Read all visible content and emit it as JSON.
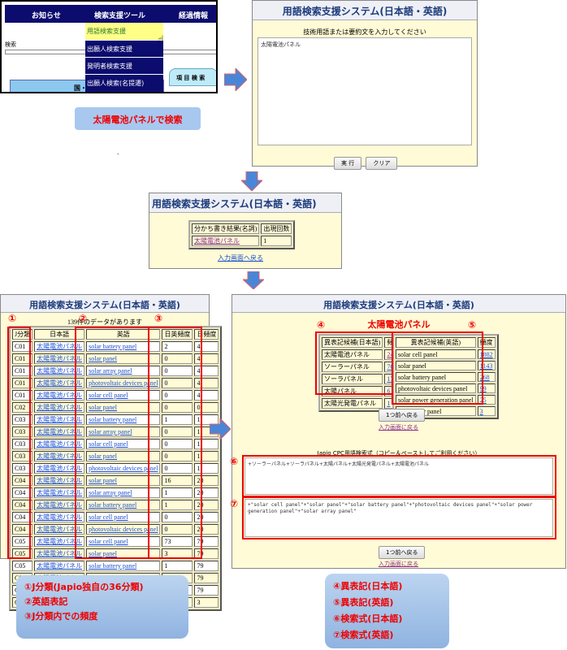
{
  "portal": {
    "nav": [
      "お知らせ",
      "検索支援ツール",
      "経過情報"
    ],
    "dropdown": [
      "用語検索支援",
      "出願人検索支援",
      "発明者検索支援",
      "出願人検索(名提遷)"
    ],
    "search_label": "検索",
    "section_label": "国・公報",
    "tab_label": "項 目 検 索"
  },
  "callout_search": "太陽電池パネルで検索",
  "input_screen": {
    "title": "用語検索支援システム(日本語・英語)",
    "prompt": "技術用語または要約文を入力してください",
    "value": "太陽電池パネル",
    "run": "実 行",
    "clear": "クリア"
  },
  "dot": ".",
  "split_screen": {
    "title": "用語検索支援システム(日本語・英語)",
    "headers": [
      "分かち書き結果(名詞)",
      "出現回数"
    ],
    "rows": [
      {
        "term": "太陽電池パネル",
        "count": "1"
      }
    ],
    "back_link": "入力画面へ戻る"
  },
  "list_screen": {
    "title": "用語検索支援システム(日本語・英語)",
    "count_text": "139件のデータがあります",
    "headers": [
      "J分類",
      "日本語",
      "英語",
      "日英頻度",
      "日頻度"
    ],
    "rows": [
      [
        "C01",
        "太陽電池パネル",
        "solar battery panel",
        "2",
        "4"
      ],
      [
        "C01",
        "太陽電池パネル",
        "solar panel",
        "0",
        "4"
      ],
      [
        "C01",
        "太陽電池パネル",
        "solar array panel",
        "0",
        "4"
      ],
      [
        "C01",
        "太陽電池パネル",
        "photovoltaic devices panel",
        "0",
        "4"
      ],
      [
        "C01",
        "太陽電池パネル",
        "solar cell panel",
        "0",
        "4"
      ],
      [
        "C02",
        "太陽電池パネル",
        "solar panel",
        "0",
        "0"
      ],
      [
        "C03",
        "太陽電池パネル",
        "solar battery panel",
        "1",
        "1"
      ],
      [
        "C03",
        "太陽電池パネル",
        "solar array panel",
        "0",
        "1"
      ],
      [
        "C03",
        "太陽電池パネル",
        "solar cell panel",
        "0",
        "1"
      ],
      [
        "C03",
        "太陽電池パネル",
        "solar panel",
        "0",
        "1"
      ],
      [
        "C03",
        "太陽電池パネル",
        "photovoltaic devices panel",
        "0",
        "1"
      ],
      [
        "C04",
        "太陽電池パネル",
        "solar panel",
        "16",
        "20"
      ],
      [
        "C04",
        "太陽電池パネル",
        "solar array panel",
        "1",
        "20"
      ],
      [
        "C04",
        "太陽電池パネル",
        "solar battery panel",
        "1",
        "20"
      ],
      [
        "C04",
        "太陽電池パネル",
        "solar cell panel",
        "0",
        "20"
      ],
      [
        "C04",
        "太陽電池パネル",
        "photovoltaic devices panel",
        "0",
        "20"
      ],
      [
        "C05",
        "太陽電池パネル",
        "solar cell panel",
        "73",
        "79"
      ],
      [
        "C05",
        "太陽電池パネル",
        "solar panel",
        "3",
        "79"
      ],
      [
        "C05",
        "太陽電池パネル",
        "solar battery panel",
        "1",
        "79"
      ],
      [
        "C05",
        "太陽電池パネル",
        "solar array panel",
        "0",
        "79"
      ],
      [
        "C05",
        "太陽電池パネル",
        "photovoltaic devices panel",
        "0",
        "79"
      ],
      [
        "C06",
        "太陽電池パネル",
        "solar cell panel",
        "2",
        "3"
      ]
    ]
  },
  "variant_screen": {
    "title": "用語検索支援システム(日本語・英語)",
    "term": "太陽電池パネル",
    "ja_headers": [
      "異表記候補(日本語)",
      "頻度"
    ],
    "ja_rows": [
      [
        "太陽電池パネル",
        "2447"
      ],
      [
        "ソーラーパネル",
        "766"
      ],
      [
        "ソーラパネル",
        "175"
      ],
      [
        "太陽パネル",
        "6"
      ],
      [
        "太陽光発電パネル",
        "1"
      ]
    ],
    "en_headers": [
      "異表記候補(英語)",
      "頻度"
    ],
    "en_rows": [
      [
        "solar cell panel",
        "1882"
      ],
      [
        "solar panel",
        "1143"
      ],
      [
        "solar battery panel",
        "268"
      ],
      [
        "photovoltaic devices panel",
        "99"
      ],
      [
        "solar power generation panel",
        "25"
      ],
      [
        "solar array panel",
        "3"
      ]
    ],
    "back_button": "1つ前へ戻る",
    "input_link": "入力画面に戻る",
    "formula_label": "Japio CPC用語検索式（コピー＆ペーストしてご利用ください）",
    "formula_ja": "+ソーラーパネル+ソーラパネル+太陽パネル+太陽光発電パネル+太陽電池パネル",
    "formula_en": "+\"solar cell panel\"+\"solar panel\"+\"solar battery panel\"+\"photovoltaic devices panel\"+\"solar power generation panel\"+\"solar array panel\""
  },
  "markers": [
    "①",
    "②",
    "③",
    "④",
    "⑤",
    "⑥",
    "⑦"
  ],
  "legend_left": [
    "①J分類(Japio独自の36分類)",
    "②英語表記",
    "③J分類内での頻度"
  ],
  "legend_right": [
    "④異表記(日本語)",
    "⑤異表記(英語)",
    "⑥検索式(日本語)",
    "⑦検索式(英語)"
  ],
  "colors": {
    "nav": "#0c0c6e",
    "highlight": "#ffff88",
    "marker": "#ee0000",
    "arrow": "#4a86d8"
  }
}
